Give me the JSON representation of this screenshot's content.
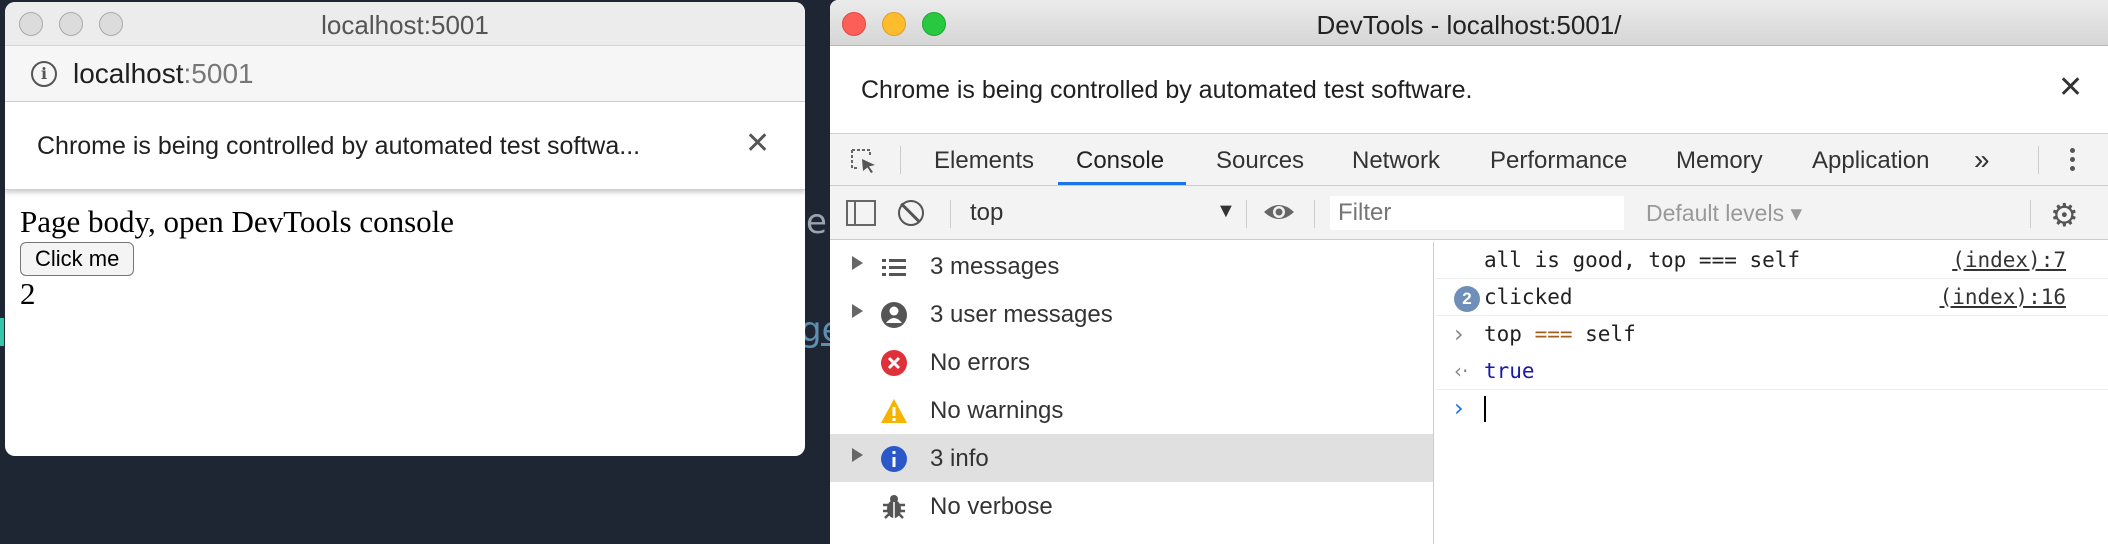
{
  "background": {
    "peek_text_1": "e",
    "peek_text_2": "ge"
  },
  "left_window": {
    "title": "localhost:5001",
    "address": {
      "host": "localhost",
      "port": ":5001"
    },
    "infobar_text": "Chrome is being controlled by automated test softwa...",
    "page": {
      "heading": "Page body, open DevTools console",
      "button_label": "Click me",
      "count": "2"
    }
  },
  "devtools": {
    "title": "DevTools - localhost:5001/",
    "infobar_text": "Chrome is being controlled by automated test software.",
    "tabs": [
      "Elements",
      "Console",
      "Sources",
      "Network",
      "Performance",
      "Memory",
      "Application"
    ],
    "active_tab": "Console",
    "more_tabs_label": "»",
    "toolbar": {
      "context": "top",
      "filter_placeholder": "Filter",
      "levels": "Default levels ▾"
    },
    "sidebar": [
      {
        "label": "3 messages",
        "icon": "list-icon",
        "expandable": true
      },
      {
        "label": "3 user messages",
        "icon": "user-icon",
        "expandable": true
      },
      {
        "label": "No errors",
        "icon": "error-icon",
        "expandable": false
      },
      {
        "label": "No warnings",
        "icon": "warning-icon",
        "expandable": false
      },
      {
        "label": "3 info",
        "icon": "info-icon",
        "expandable": true,
        "selected": true
      },
      {
        "label": "No verbose",
        "icon": "bug-icon",
        "expandable": false
      }
    ],
    "console": {
      "log1": {
        "text": "all is good, top === self",
        "source": "(index):7"
      },
      "log2": {
        "count": "2",
        "text": "clicked",
        "source": "(index):16"
      },
      "input": {
        "a": "top ",
        "op": "===",
        "b": " self"
      },
      "result": "true"
    }
  },
  "colors": {
    "accent": "#1a73e8",
    "close_red": "#fc5f57",
    "minimize_yellow": "#fdbc2e",
    "maximize_green": "#28c840"
  }
}
